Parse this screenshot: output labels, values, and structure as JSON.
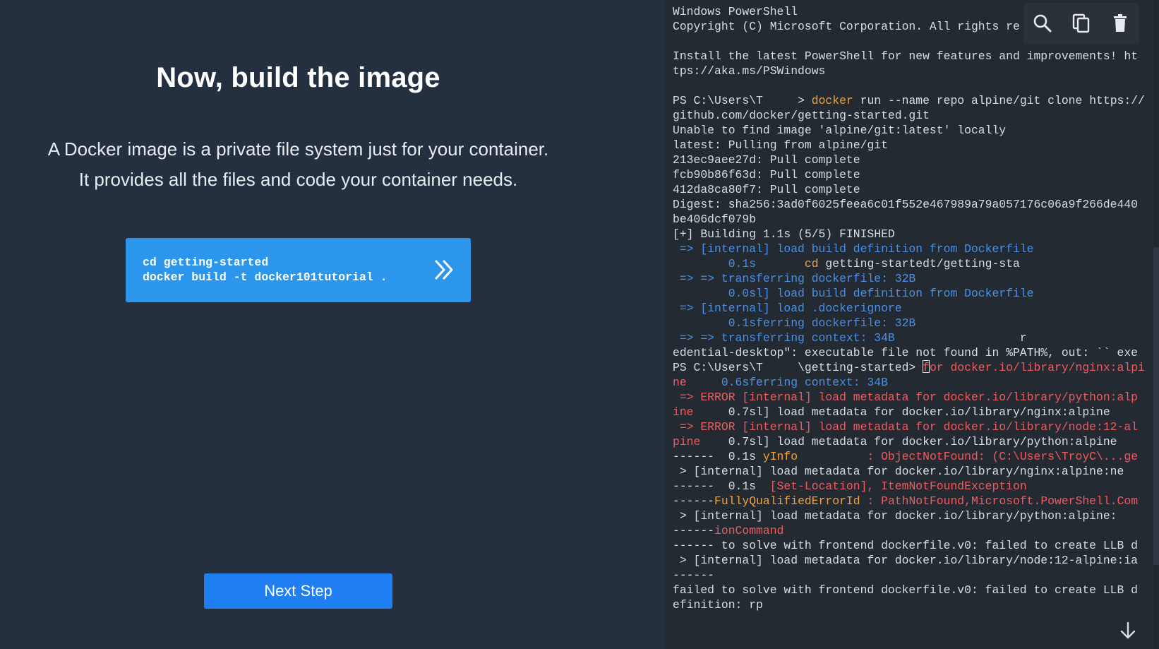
{
  "tutorial": {
    "title": "Now, build the image",
    "description_line1": "A Docker image is a private file system just for your container.",
    "description_line2": "It provides all the files and code your container needs.",
    "command_line1": "cd getting-started",
    "command_line2": "docker build -t docker101tutorial .",
    "run_icon": "double-chevron-right-icon",
    "next_button": "Next Step"
  },
  "toolbar": {
    "icons": [
      "search-icon",
      "copy-icon",
      "trash-icon"
    ]
  },
  "terminal": {
    "lines": [
      [
        {
          "t": "Windows PowerShell",
          "c": "default"
        }
      ],
      [
        {
          "t": "Copyright (C) Microsoft Corporation. All rights re",
          "c": "default"
        }
      ],
      [
        {
          "t": "",
          "c": "default"
        }
      ],
      [
        {
          "t": "Install the latest PowerShell for new features and improvements! ht",
          "c": "default"
        }
      ],
      [
        {
          "t": "tps://aka.ms/PSWindows",
          "c": "default"
        }
      ],
      [
        {
          "t": "",
          "c": "default"
        }
      ],
      [
        {
          "t": "PS C:\\Users\\T     > ",
          "c": "default"
        },
        {
          "t": "docker",
          "c": "orange"
        },
        {
          "t": " run --name repo alpine/git clone https://",
          "c": "default"
        }
      ],
      [
        {
          "t": "github.com/docker/getting-started.git",
          "c": "default"
        }
      ],
      [
        {
          "t": "Unable to find image 'alpine/git:latest' locally",
          "c": "default"
        }
      ],
      [
        {
          "t": "latest: Pulling from alpine/git",
          "c": "default"
        }
      ],
      [
        {
          "t": "213ec9aee27d: Pull complete",
          "c": "default"
        }
      ],
      [
        {
          "t": "fcb90b86f63d: Pull complete",
          "c": "default"
        }
      ],
      [
        {
          "t": "412da8ca80f7: Pull complete",
          "c": "default"
        }
      ],
      [
        {
          "t": "Digest: sha256:3ad0f6025feea6c01f552e467989a79a057176c06a9f266de440",
          "c": "default"
        }
      ],
      [
        {
          "t": "be406dcf079b",
          "c": "default"
        }
      ],
      [
        {
          "t": "[+] Building 1.1s (5/5) FINISHED",
          "c": "default"
        }
      ],
      [
        {
          "t": " => [internal] load build definition from Dockerfile",
          "c": "blue"
        }
      ],
      [
        {
          "t": "        0.1s",
          "c": "blue"
        },
        {
          "t": "       ",
          "c": "default"
        },
        {
          "t": "cd",
          "c": "orange"
        },
        {
          "t": " getting-startedt/getting-sta",
          "c": "default"
        }
      ],
      [
        {
          "t": " => => transferring dockerfile: 32B",
          "c": "blue"
        }
      ],
      [
        {
          "t": "        0.0sl] load build definition from Dockerfile",
          "c": "blue"
        }
      ],
      [
        {
          "t": " => [internal] load .dockerignore",
          "c": "blue"
        }
      ],
      [
        {
          "t": "        0.1sferring dockerfile: 32B",
          "c": "blue"
        }
      ],
      [
        {
          "t": " => => transferring context: 34B",
          "c": "blue"
        },
        {
          "t": "                  r",
          "c": "default"
        }
      ],
      [
        {
          "t": "edential-desktop\": executable file not found in %PATH%, out: `` exe",
          "c": "default"
        }
      ],
      [
        {
          "t": "PS C:\\Users\\T     \\getting-started> ",
          "c": "default"
        },
        {
          "t": "[]",
          "c": "cursor"
        },
        {
          "t": "for docker.io/library/nginx:alpi",
          "c": "red"
        }
      ],
      [
        {
          "t": "ne",
          "c": "red"
        },
        {
          "t": "     0.6sferring context: 34B",
          "c": "blue"
        }
      ],
      [
        {
          "t": " => ERROR [internal] load metadata for docker.io/library/python:alp",
          "c": "red"
        }
      ],
      [
        {
          "t": "ine",
          "c": "red"
        },
        {
          "t": "     0.7sl] load metadata for docker.io/library/nginx:alpine",
          "c": "default"
        }
      ],
      [
        {
          "t": " => ERROR [internal] load metadata for docker.io/library/node:12-al",
          "c": "red"
        }
      ],
      [
        {
          "t": "pine",
          "c": "red"
        },
        {
          "t": "    0.7sl] load metadata for docker.io/library/python:alpine",
          "c": "default"
        }
      ],
      [
        {
          "t": "------  0.1s ",
          "c": "default"
        },
        {
          "t": "yInfo",
          "c": "orange"
        },
        {
          "t": "          : ObjectNotFound: (C:\\Users\\TroyC\\...ge",
          "c": "red"
        }
      ],
      [
        {
          "t": " > [internal] load metadata for docker.io/library/nginx:alpine:ne",
          "c": "default"
        }
      ],
      [
        {
          "t": "------  0.1s  ",
          "c": "default"
        },
        {
          "t": "[Set-Location], ItemNotFoundException",
          "c": "red"
        }
      ],
      [
        {
          "t": "------",
          "c": "default"
        },
        {
          "t": "FullyQualifiedErrorId",
          "c": "orange"
        },
        {
          "t": " : PathNotFound,Microsoft.PowerShell.Com",
          "c": "red"
        }
      ],
      [
        {
          "t": " > [internal] load metadata for docker.io/library/python:alpine:",
          "c": "default"
        }
      ],
      [
        {
          "t": "------",
          "c": "default"
        },
        {
          "t": "ionCommand",
          "c": "red"
        }
      ],
      [
        {
          "t": "------ to solve with frontend dockerfile.v0: failed to create LLB d",
          "c": "default"
        }
      ],
      [
        {
          "t": " > [internal] load metadata for docker.io/library/node:12-alpine:ia",
          "c": "default"
        }
      ],
      [
        {
          "t": "------",
          "c": "default"
        }
      ],
      [
        {
          "t": "failed to solve with frontend dockerfile.v0: failed to create LLB d",
          "c": "default"
        }
      ],
      [
        {
          "t": "efinition: rp",
          "c": "default"
        }
      ]
    ],
    "scroll_icon": "arrow-down-icon"
  }
}
